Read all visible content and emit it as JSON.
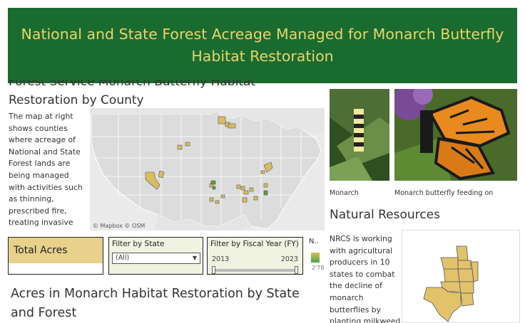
{
  "banner": {
    "title": "National and State Forest Acreage Managed for Monarch Butterfly Habitat Restoration"
  },
  "forest_map": {
    "title_line1": "Forest Service Monarch Butterfly Habitat",
    "title_line2": "Restoration by County",
    "description": "The map at right shows counties where acreage of National and State Forest lands are being managed with activities such as thinning, prescribed fire, treating invasive species, or planting native",
    "attribution": "© Mapbox  © OSM",
    "land_color": "#dcdcdc",
    "county_colors": [
      "#d9bd5e",
      "#5c9a4a"
    ]
  },
  "photos": {
    "caption1": "Monarch",
    "caption2": "Monarch butterfly feeding on"
  },
  "natural_resources": {
    "title": "Natural Resources",
    "description": "NRCS is working with agricultural producers in 10 states to combat the decline of monarch butterflies by planting milkweed",
    "state_fill": "#e2c36b"
  },
  "total_acres": {
    "label": "Total Acres"
  },
  "filter_state": {
    "label": "Filter by State",
    "selected": "(All)"
  },
  "filter_year": {
    "label": "Filter by Fiscal Year (FY)",
    "min": "2013",
    "max": "2023"
  },
  "legend": {
    "label": "N..",
    "value": "2'78"
  },
  "bottom_section": {
    "title": "Acres in Monarch Habitat Restoration by State and Forest"
  },
  "colors": {
    "banner_bg": "#1a6b2f",
    "banner_text": "#e8d56a",
    "total_fill": "#e8d18b",
    "filter_bg": "#f0f3e2"
  }
}
